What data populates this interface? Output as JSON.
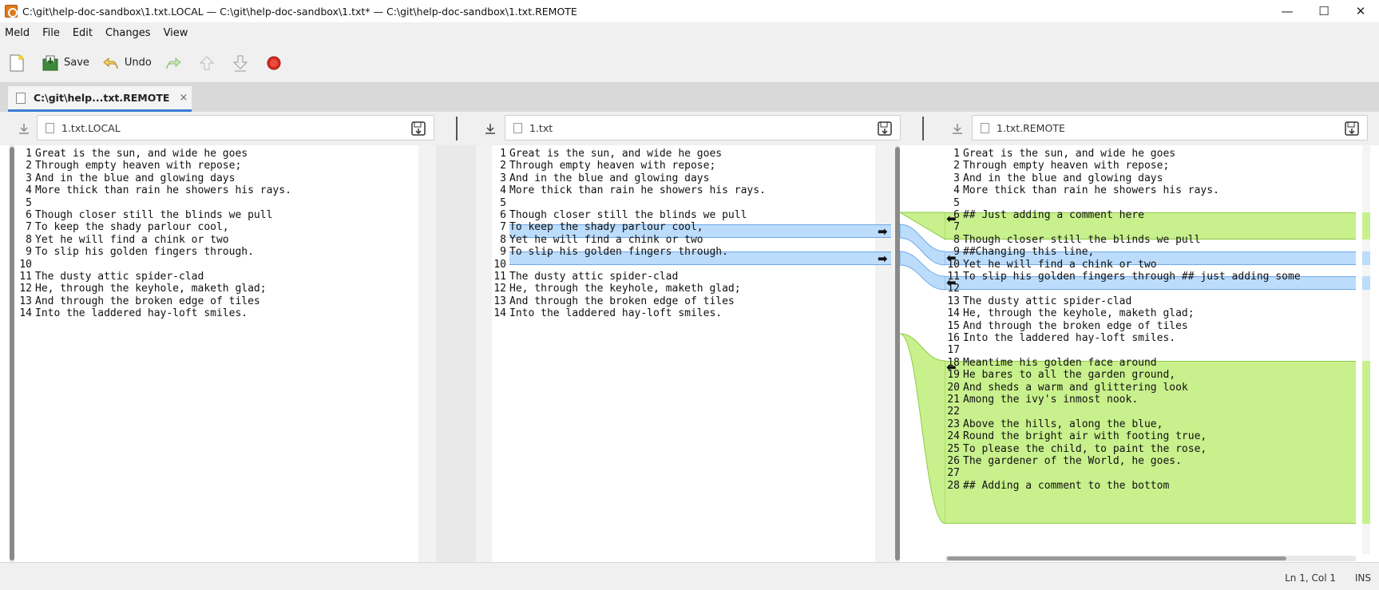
{
  "window": {
    "title": "C:\\git\\help-doc-sandbox\\1.txt.LOCAL — C:\\git\\help-doc-sandbox\\1.txt* — C:\\git\\help-doc-sandbox\\1.txt.REMOTE",
    "minimize": "—",
    "maximize": "☐",
    "close": "✕"
  },
  "menu": [
    "Meld",
    "File",
    "Edit",
    "Changes",
    "View"
  ],
  "toolbar": {
    "save_label": "Save",
    "undo_label": "Undo"
  },
  "tab": {
    "label": "C:\\git\\help...txt.REMOTE",
    "close": "×"
  },
  "files": {
    "left": "1.txt.LOCAL",
    "middle": "1.txt",
    "right": "1.txt.REMOTE"
  },
  "left_lines": [
    {
      "n": "1",
      "t": "Great is the sun, and wide he goes"
    },
    {
      "n": "2",
      "t": "Through empty heaven with repose;"
    },
    {
      "n": "3",
      "t": "And in the blue and glowing days"
    },
    {
      "n": "4",
      "t": "More thick than rain he showers his rays."
    },
    {
      "n": "5",
      "t": ""
    },
    {
      "n": "6",
      "t": "Though closer still the blinds we pull"
    },
    {
      "n": "7",
      "t": "To keep the shady parlour cool,"
    },
    {
      "n": "8",
      "t": "Yet he will find a chink or two"
    },
    {
      "n": "9",
      "t": "To slip his golden fingers through."
    },
    {
      "n": "10",
      "t": ""
    },
    {
      "n": "11",
      "t": "The dusty attic spider-clad"
    },
    {
      "n": "12",
      "t": "He, through the keyhole, maketh glad;"
    },
    {
      "n": "13",
      "t": "And through the broken edge of tiles"
    },
    {
      "n": "14",
      "t": "Into the laddered hay-loft smiles."
    }
  ],
  "middle_lines": [
    {
      "n": "1",
      "t": "Great is the sun, and wide he goes"
    },
    {
      "n": "2",
      "t": "Through empty heaven with repose;"
    },
    {
      "n": "3",
      "t": "And in the blue and glowing days"
    },
    {
      "n": "4",
      "t": "More thick than rain he showers his rays."
    },
    {
      "n": "5",
      "t": ""
    },
    {
      "n": "6",
      "t": "Though closer still the blinds we pull"
    },
    {
      "n": "7",
      "t": "To keep the shady parlour cool,"
    },
    {
      "n": "8",
      "t": "Yet he will find a chink or two"
    },
    {
      "n": "9",
      "t": "To slip his golden fingers through."
    },
    {
      "n": "10",
      "t": ""
    },
    {
      "n": "11",
      "t": "The dusty attic spider-clad"
    },
    {
      "n": "12",
      "t": "He, through the keyhole, maketh glad;"
    },
    {
      "n": "13",
      "t": "And through the broken edge of tiles"
    },
    {
      "n": "14",
      "t": "Into the laddered hay-loft smiles."
    }
  ],
  "right_lines": [
    {
      "n": "1",
      "t": "Great is the sun, and wide he goes"
    },
    {
      "n": "2",
      "t": "Through empty heaven with repose;"
    },
    {
      "n": "3",
      "t": "And in the blue and glowing days"
    },
    {
      "n": "4",
      "t": "More thick than rain he showers his rays."
    },
    {
      "n": "5",
      "t": ""
    },
    {
      "n": "6",
      "t": "## Just adding a comment here"
    },
    {
      "n": "7",
      "t": ""
    },
    {
      "n": "8",
      "t": "Though closer still the blinds we pull"
    },
    {
      "n": "9",
      "t": "##Changing this line,"
    },
    {
      "n": "10",
      "t": "Yet he will find a chink or two"
    },
    {
      "n": "11",
      "t": "To slip his golden fingers through ## just adding some"
    },
    {
      "n": "12",
      "t": ""
    },
    {
      "n": "13",
      "t": "The dusty attic spider-clad"
    },
    {
      "n": "14",
      "t": "He, through the keyhole, maketh glad;"
    },
    {
      "n": "15",
      "t": "And through the broken edge of tiles"
    },
    {
      "n": "16",
      "t": "Into the laddered hay-loft smiles."
    },
    {
      "n": "17",
      "t": ""
    },
    {
      "n": "18",
      "t": "Meantime his golden face around"
    },
    {
      "n": "19",
      "t": "He bares to all the garden ground,"
    },
    {
      "n": "20",
      "t": "And sheds a warm and glittering look"
    },
    {
      "n": "21",
      "t": "Among the ivy's inmost nook."
    },
    {
      "n": "22",
      "t": ""
    },
    {
      "n": "23",
      "t": "Above the hills, along the blue,"
    },
    {
      "n": "24",
      "t": "Round the bright air with footing true,"
    },
    {
      "n": "25",
      "t": "To please the child, to paint the rose,"
    },
    {
      "n": "26",
      "t": "The gardener of the World, he goes."
    },
    {
      "n": "27",
      "t": ""
    },
    {
      "n": "28",
      "t": "## Adding a comment to the bottom"
    }
  ],
  "status": {
    "position": "Ln 1, Col 1",
    "mode": "INS"
  },
  "colors": {
    "changed": "#bcdcfb",
    "changed_highlight": "#8ec2f5",
    "inserted": "#c8f08c",
    "accent": "#3a7bd5"
  }
}
